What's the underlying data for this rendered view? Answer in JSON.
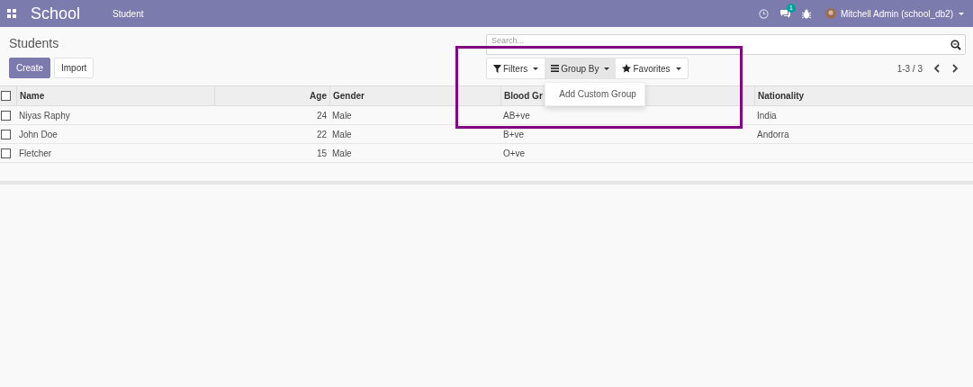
{
  "navbar": {
    "app_name": "School",
    "menu": [
      {
        "label": "Student"
      }
    ],
    "messages_badge": "1",
    "user": "Mitchell Admin (school_db2)"
  },
  "control_panel": {
    "title": "Students",
    "buttons": [
      {
        "label": "Create",
        "kind": "primary"
      },
      {
        "label": "Import",
        "kind": "secondary"
      }
    ],
    "search": {
      "placeholder": "Search..."
    },
    "facets": [
      {
        "label": "Filters",
        "kind": "filter",
        "selected": false
      },
      {
        "label": "Group By",
        "kind": "group",
        "selected": true
      },
      {
        "label": "Favorites",
        "kind": "star",
        "selected": false
      }
    ],
    "dropdown": {
      "items": [
        "Add Custom Group"
      ]
    },
    "pager": "1-3 / 3"
  },
  "table": {
    "all_selected": false,
    "columns": [
      {
        "label": "Name",
        "kind": "text"
      },
      {
        "label": "Age",
        "kind": "number"
      },
      {
        "label": "Gender",
        "kind": "text"
      },
      {
        "label": "Blood Gr",
        "kind": "text"
      },
      {
        "label": "Nationality",
        "kind": "text"
      }
    ],
    "rows": [
      {
        "selected": false,
        "cells": [
          "Niyas Raphy",
          "24",
          "Male",
          "AB+ve",
          "India"
        ]
      },
      {
        "selected": false,
        "cells": [
          "John Doe",
          "22",
          "Male",
          "B+ve",
          "Andorra"
        ]
      },
      {
        "selected": false,
        "cells": [
          "Fletcher",
          "15",
          "Male",
          "O+ve",
          ""
        ]
      }
    ]
  }
}
